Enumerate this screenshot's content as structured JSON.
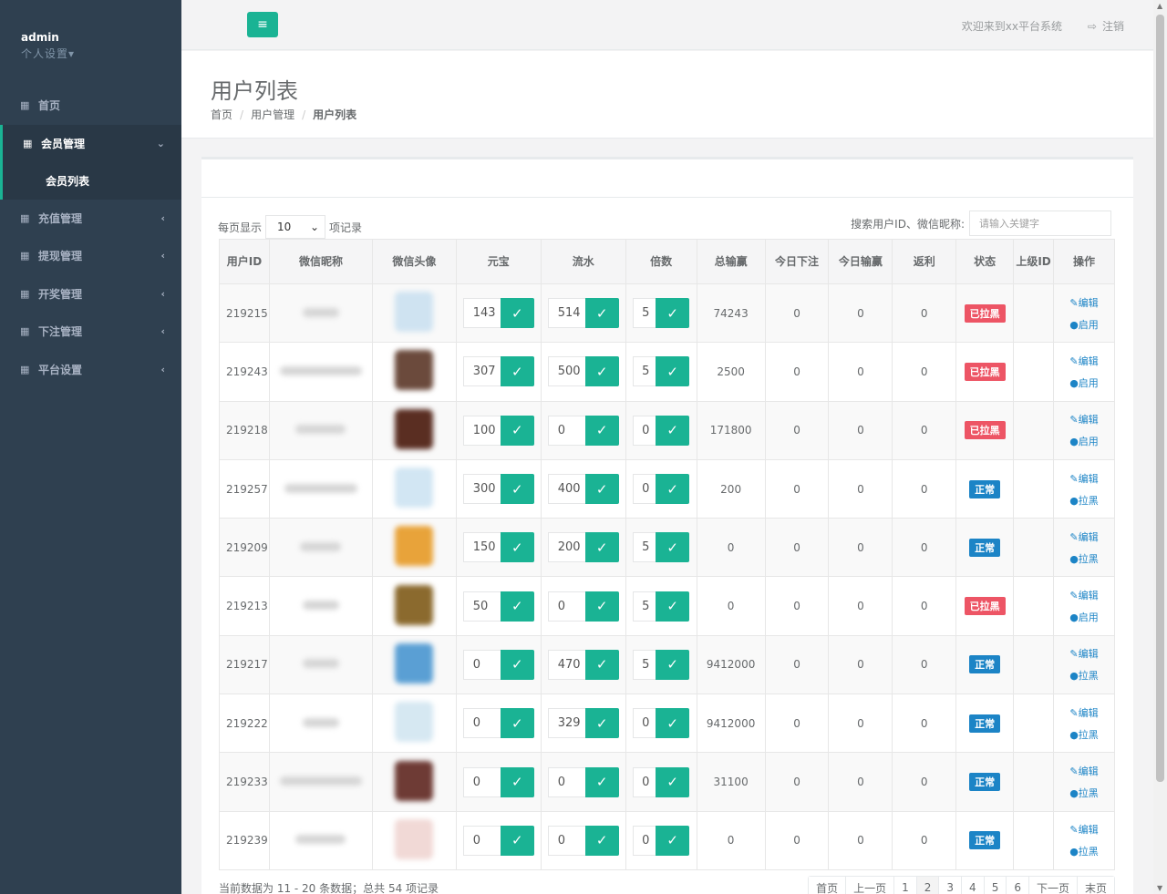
{
  "sidebar": {
    "user": "admin",
    "settings": "个人设置▾",
    "items": [
      {
        "label": "首页",
        "icon": "grid-icon"
      },
      {
        "label": "会员管理",
        "icon": "grid-icon"
      },
      {
        "label": "充值管理",
        "icon": "grid-icon"
      },
      {
        "label": "提现管理",
        "icon": "grid-icon"
      },
      {
        "label": "开奖管理",
        "icon": "grid-icon"
      },
      {
        "label": "下注管理",
        "icon": "grid-icon"
      },
      {
        "label": "平台设置",
        "icon": "grid-icon"
      }
    ],
    "sub_item": "会员列表"
  },
  "topbar": {
    "welcome": "欢迎来到xx平台系统",
    "logout": "注销"
  },
  "heading": {
    "title": "用户列表",
    "crumbs": [
      "首页",
      "用户管理",
      "用户列表"
    ]
  },
  "controls": {
    "show_prefix": "每页显示",
    "page_size": "10",
    "show_suffix": "项记录",
    "search_label": "搜索用户ID、微信昵称:",
    "search_placeholder": "请输入关键字"
  },
  "table": {
    "headers": [
      "用户ID",
      "微信昵称",
      "微信头像",
      "元宝",
      "流水",
      "倍数",
      "总输赢",
      "今日下注",
      "今日输赢",
      "返利",
      "状态",
      "上级ID",
      "操作"
    ],
    "rows": [
      {
        "id": "219215",
        "yuanbao": "143",
        "liushui": "514",
        "beishu": "5",
        "total": "74243",
        "today_bet": "0",
        "today_win": "0",
        "rebate": "0",
        "status": "已拉黑",
        "status_color": "#ed5565",
        "op1": "编辑",
        "op2": "启用",
        "avatar": "#cfe3f1"
      },
      {
        "id": "219243",
        "yuanbao": "307",
        "liushui": "500",
        "beishu": "5",
        "total": "2500",
        "today_bet": "0",
        "today_win": "0",
        "rebate": "0",
        "status": "已拉黑",
        "status_color": "#ed5565",
        "op1": "编辑",
        "op2": "启用",
        "avatar": "#6b4a3c"
      },
      {
        "id": "219218",
        "yuanbao": "100",
        "liushui": "0",
        "beishu": "0",
        "total": "171800",
        "today_bet": "0",
        "today_win": "0",
        "rebate": "0",
        "status": "已拉黑",
        "status_color": "#ed5565",
        "op1": "编辑",
        "op2": "启用",
        "avatar": "#5a2e22"
      },
      {
        "id": "219257",
        "yuanbao": "300",
        "liushui": "400",
        "beishu": "0",
        "total": "200",
        "today_bet": "0",
        "today_win": "0",
        "rebate": "0",
        "status": "正常",
        "status_color": "#1c84c6",
        "op1": "编辑",
        "op2": "拉黑",
        "avatar": "#d2e6f3"
      },
      {
        "id": "219209",
        "yuanbao": "150",
        "liushui": "200",
        "beishu": "5",
        "total": "0",
        "today_bet": "0",
        "today_win": "0",
        "rebate": "0",
        "status": "正常",
        "status_color": "#1c84c6",
        "op1": "编辑",
        "op2": "拉黑",
        "avatar": "#e8a33a"
      },
      {
        "id": "219213",
        "yuanbao": "50",
        "liushui": "0",
        "beishu": "5",
        "total": "0",
        "today_bet": "0",
        "today_win": "0",
        "rebate": "0",
        "status": "已拉黑",
        "status_color": "#ed5565",
        "op1": "编辑",
        "op2": "启用",
        "avatar": "#8b6a2e"
      },
      {
        "id": "219217",
        "yuanbao": "0",
        "liushui": "470",
        "beishu": "5",
        "total": "9412000",
        "today_bet": "0",
        "today_win": "0",
        "rebate": "0",
        "status": "正常",
        "status_color": "#1c84c6",
        "op1": "编辑",
        "op2": "拉黑",
        "avatar": "#5a9fd4"
      },
      {
        "id": "219222",
        "yuanbao": "0",
        "liushui": "329",
        "beishu": "0",
        "total": "9412000",
        "today_bet": "0",
        "today_win": "0",
        "rebate": "0",
        "status": "正常",
        "status_color": "#1c84c6",
        "op1": "编辑",
        "op2": "拉黑",
        "avatar": "#d6e8f2"
      },
      {
        "id": "219233",
        "yuanbao": "0",
        "liushui": "0",
        "beishu": "0",
        "total": "31100",
        "today_bet": "0",
        "today_win": "0",
        "rebate": "0",
        "status": "正常",
        "status_color": "#1c84c6",
        "op1": "编辑",
        "op2": "拉黑",
        "avatar": "#6e3b35"
      },
      {
        "id": "219239",
        "yuanbao": "0",
        "liushui": "0",
        "beishu": "0",
        "total": "0",
        "today_bet": "0",
        "today_win": "0",
        "rebate": "0",
        "status": "正常",
        "status_color": "#1c84c6",
        "op1": "编辑",
        "op2": "拉黑",
        "avatar": "#f1d9d6"
      }
    ]
  },
  "footer": {
    "info": "当前数据为 11 - 20 条数据；总共 54 项记录",
    "pages": [
      "首页",
      "上一页",
      "1",
      "2",
      "3",
      "4",
      "5",
      "6",
      "下一页",
      "末页"
    ],
    "current_page": "2"
  },
  "colors": {
    "accent": "#1ab394",
    "sidebar_bg": "#2f4050",
    "danger": "#ed5565",
    "info": "#1c84c6"
  }
}
